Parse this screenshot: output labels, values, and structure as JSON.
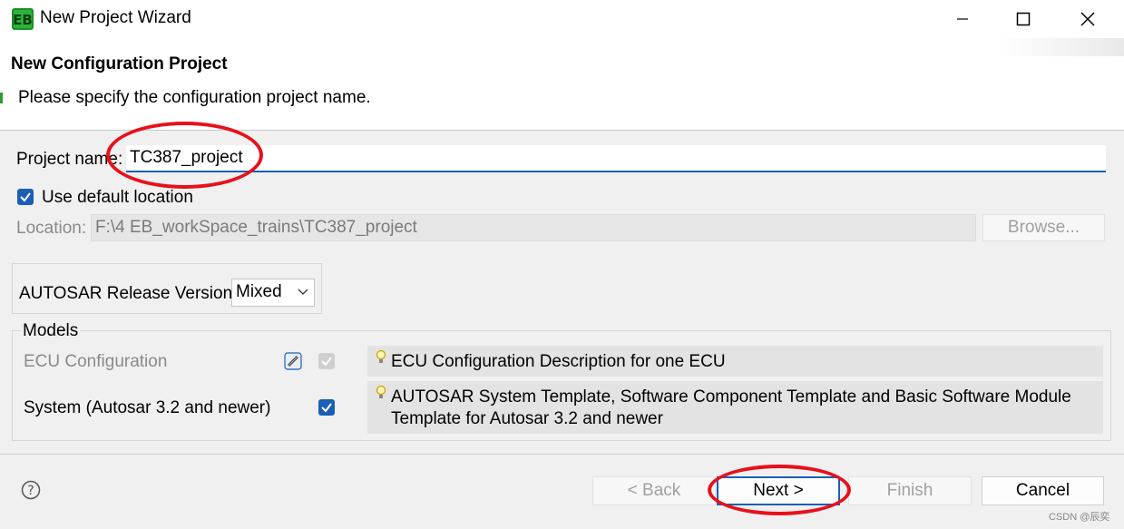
{
  "window": {
    "title": "New Project Wizard",
    "minimize_label": "—",
    "maximize_label": "☐",
    "close_label": "✕"
  },
  "header": {
    "title": "New Configuration Project",
    "description": "Please specify the configuration project name."
  },
  "form": {
    "project_name_label": "Project name:",
    "project_name_value": "TC387_project",
    "use_default_location_label": "Use default location",
    "use_default_location_checked": true,
    "location_label": "Location:",
    "location_value": "F:\\4 EB_workSpace_trains\\TC387_project",
    "browse_label": "Browse...",
    "autosar_label": "AUTOSAR Release Version:",
    "autosar_value": "Mixed"
  },
  "models": {
    "group_label": "Models",
    "items": [
      {
        "name": "ECU Configuration",
        "checked": true,
        "enabled": false,
        "description": "ECU Configuration Description for one ECU"
      },
      {
        "name": "System (Autosar 3.2 and newer)",
        "checked": true,
        "enabled": true,
        "description_line1": "AUTOSAR System Template, Software Component Template and Basic Software Module",
        "description_line2": "Template for Autosar 3.2 and newer"
      }
    ]
  },
  "footer": {
    "help_label": "?",
    "back_label": "< Back",
    "next_label": "Next >",
    "finish_label": "Finish",
    "cancel_label": "Cancel",
    "watermark": "CSDN @辰奕"
  },
  "colors": {
    "accent": "#1a5fb4",
    "annotation": "#e8101a",
    "brand_green": "#2e9d2e"
  }
}
